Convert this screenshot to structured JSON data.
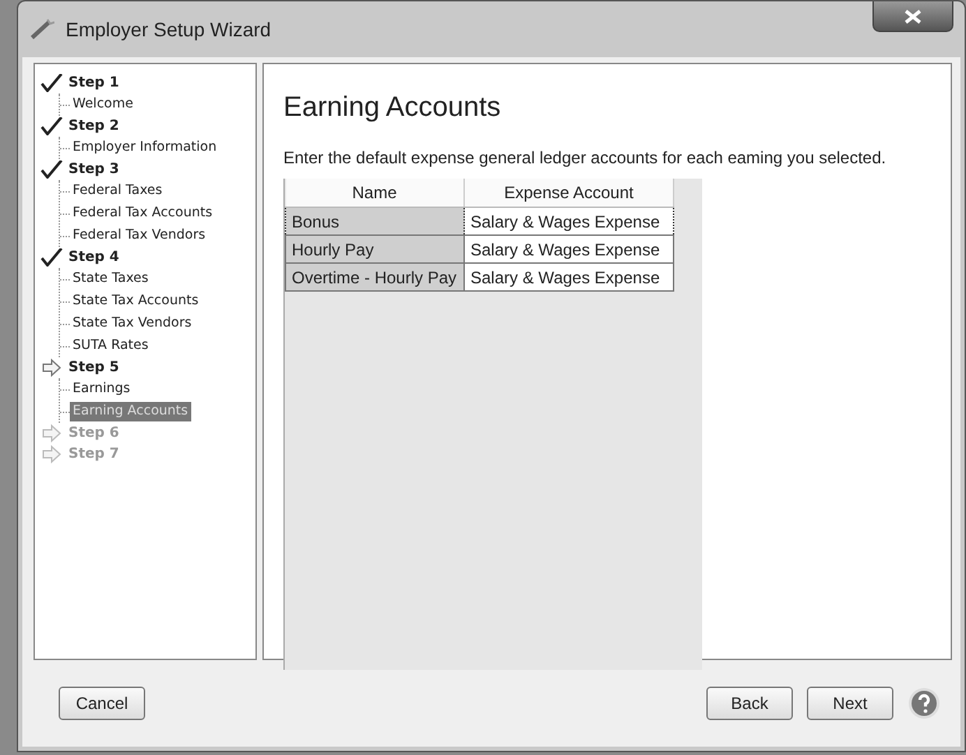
{
  "window": {
    "title": "Employer Setup Wizard"
  },
  "steps": [
    {
      "label": "Step 1",
      "kind": "done",
      "children": [
        {
          "label": "Welcome",
          "selected": false
        }
      ]
    },
    {
      "label": "Step 2",
      "kind": "done",
      "children": [
        {
          "label": "Employer Information",
          "selected": false
        }
      ]
    },
    {
      "label": "Step 3",
      "kind": "done",
      "children": [
        {
          "label": "Federal Taxes",
          "selected": false
        },
        {
          "label": "Federal Tax Accounts",
          "selected": false
        },
        {
          "label": "Federal Tax Vendors",
          "selected": false
        }
      ]
    },
    {
      "label": "Step 4",
      "kind": "done",
      "children": [
        {
          "label": "State Taxes",
          "selected": false
        },
        {
          "label": "State Tax Accounts",
          "selected": false
        },
        {
          "label": "State Tax Vendors",
          "selected": false
        },
        {
          "label": "SUTA Rates",
          "selected": false
        }
      ]
    },
    {
      "label": "Step 5",
      "kind": "current",
      "children": [
        {
          "label": "Earnings",
          "selected": false
        },
        {
          "label": "Earning Accounts",
          "selected": true
        }
      ]
    },
    {
      "label": "Step 6",
      "kind": "pending"
    },
    {
      "label": "Step 7",
      "kind": "pending"
    }
  ],
  "page": {
    "title": "Earning Accounts",
    "instructions": "Enter the default expense general ledger accounts for each eaming you selected."
  },
  "table": {
    "columns": [
      "Name",
      "Expense Account"
    ],
    "rows": [
      {
        "cells": [
          "Bonus",
          "Salary & Wages Expense"
        ],
        "selected": true
      },
      {
        "cells": [
          "Hourly Pay",
          "Salary & Wages Expense"
        ],
        "selected": false
      },
      {
        "cells": [
          "Overtime - Hourly Pay",
          "Salary & Wages Expense"
        ],
        "selected": false
      }
    ]
  },
  "buttons": {
    "left": [
      "Cancel"
    ],
    "right": [
      "Back",
      "Next"
    ]
  }
}
